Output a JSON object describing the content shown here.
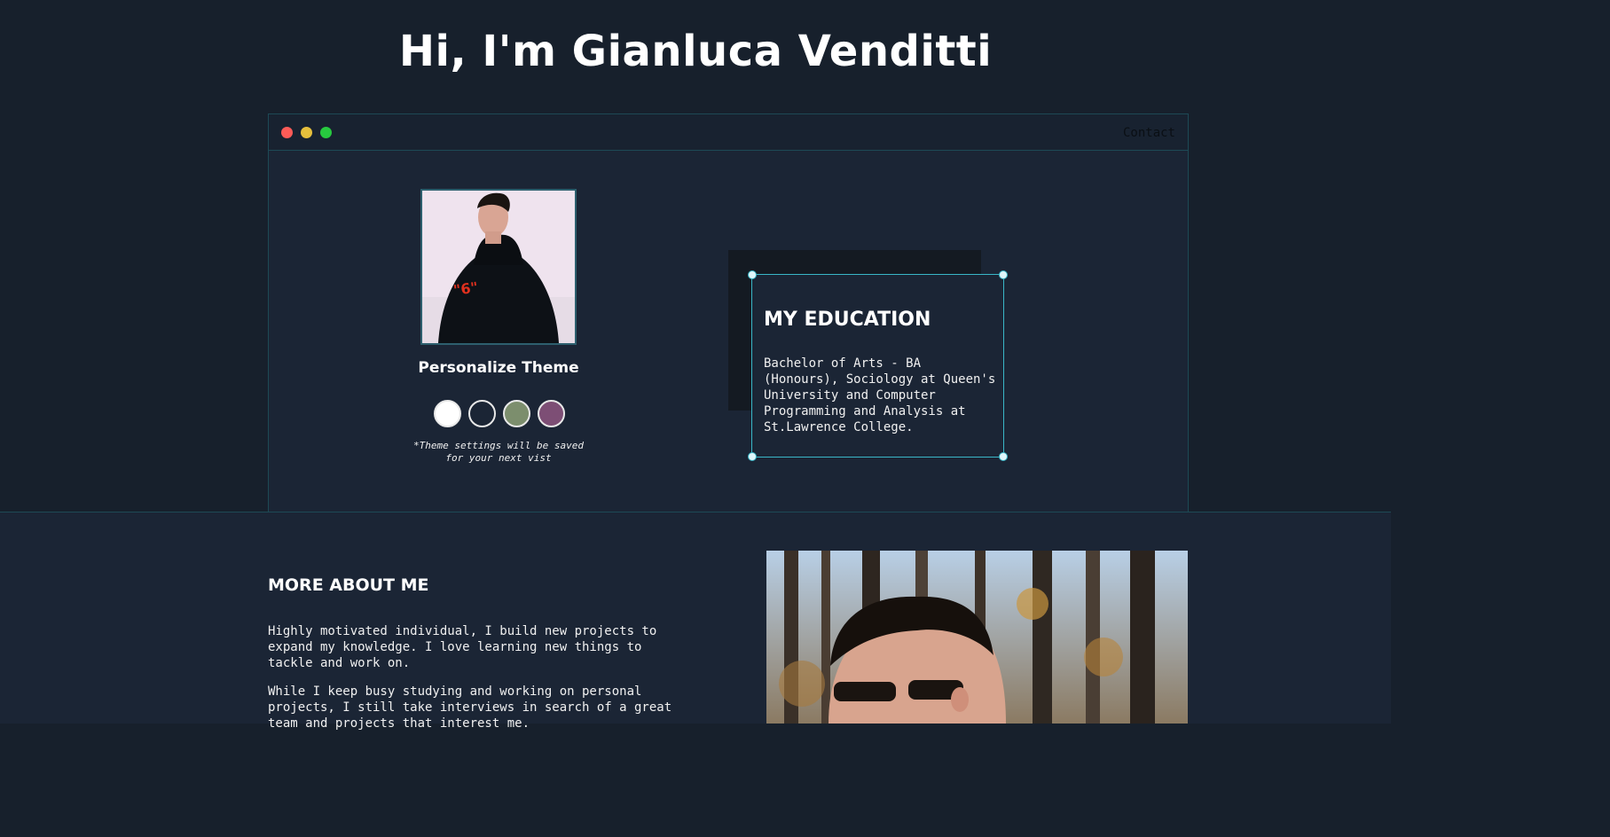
{
  "header": {
    "title": "Hi, I'm Gianluca Venditti"
  },
  "window": {
    "controls": [
      "close-dot",
      "minimize-dot",
      "maximize-dot"
    ],
    "nav_contact": "Contact"
  },
  "profile": {
    "avatar_alt": "Portrait photo"
  },
  "theme": {
    "label": "Personalize Theme",
    "swatches": [
      {
        "name": "white",
        "color": "#ffffff"
      },
      {
        "name": "navy",
        "color": "#1b2535"
      },
      {
        "name": "sage",
        "color": "#7c8e6d"
      },
      {
        "name": "plum",
        "color": "#7d4e75"
      }
    ],
    "note": "*Theme settings will be saved for your next vist"
  },
  "education": {
    "title": "MY EDUCATION",
    "text": "Bachelor of Arts - BA (Honours), Sociology at Queen's University and Computer Programming and Analysis at St.Lawrence College."
  },
  "about": {
    "title": "MORE ABOUT ME",
    "paragraphs": [
      "Highly motivated individual, I build new projects to expand my knowledge. I love learning new things to tackle and work on.",
      "While I keep busy studying and working on personal projects, I still take interviews in search of a great team and projects that interest me."
    ]
  },
  "colors": {
    "background": "#17202c",
    "panel": "#1b2535",
    "accent_border": "#39b6c7"
  }
}
